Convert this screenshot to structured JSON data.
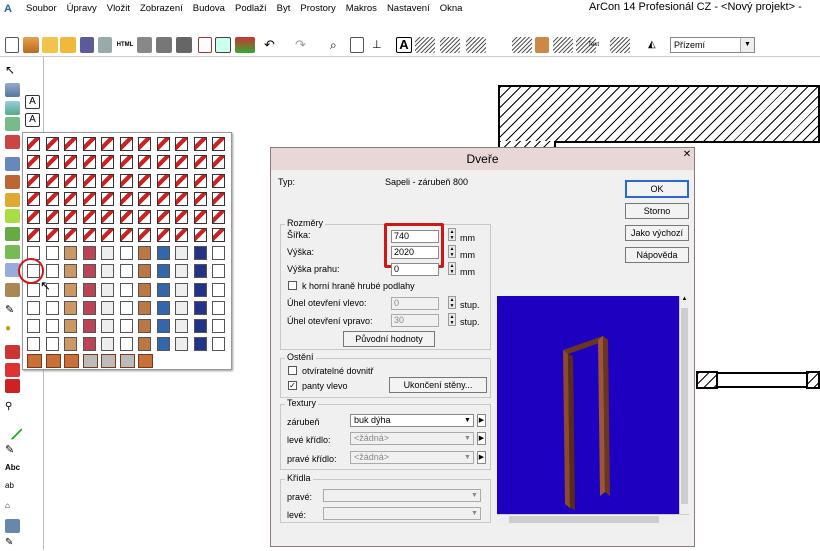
{
  "app": {
    "title": "ArCon 14 Profesionál CZ - <Nový projekt> -",
    "menu": [
      "Soubor",
      "Úpravy",
      "Vložit",
      "Zobrazení",
      "Budova",
      "Podlaží",
      "Byt",
      "Prostory",
      "Makros",
      "Nastavení",
      "Okna"
    ]
  },
  "toolbar": {
    "floor_value": "Přízemí",
    "labels": {
      "html": "HTML",
      "text": "Text"
    }
  },
  "left_toolbar": {
    "text_tool": "Abc"
  },
  "dialog": {
    "title": "Dveře",
    "type_label": "Typ:",
    "type_value": "Sapeli - zárubeň 800",
    "buttons": {
      "ok": "OK",
      "cancel": "Storno",
      "default": "Jako výchozí",
      "help": "Nápověda"
    },
    "rozmery": {
      "label": "Rozměry",
      "sirka_label": "Šířka:",
      "sirka_value": "740",
      "vyska_label": "Výška:",
      "vyska_value": "2020",
      "prah_label": "Výška prahu:",
      "prah_value": "0",
      "unit": "mm",
      "checkbox_label": "k horní hraně hrubé podlahy",
      "uhel_vlevo_label": "Úhel otevření vlevo:",
      "uhel_vlevo_value": "0",
      "uhel_vpravo_label": "Úhel otevření vpravo:",
      "uhel_vpravo_value": "30",
      "angle_unit": "stup.",
      "reset_button": "Původní hodnoty"
    },
    "osteni": {
      "label": "Ostění",
      "cb1_label": "otvíratelné dovnitř",
      "cb1_checked": false,
      "cb2_label": "panty vlevo",
      "cb2_checked": true,
      "walls_button": "Ukončení stěny..."
    },
    "textury": {
      "label": "Textury",
      "zarubne_label": "zárubeň",
      "zarubne_value": "buk dýha",
      "leve_label": "levé křídlo:",
      "leve_value": "<žádná>",
      "prave_label": "pravé křídlo:",
      "prave_value": "<žádná>"
    },
    "kridla": {
      "label": "Křídla",
      "prave_label": "pravé:",
      "leve_label": "levé:"
    }
  },
  "colors": {
    "accent_red": "#cc1818",
    "preview_bg": "#1e00c0",
    "door_frame": "#8b4a2e"
  }
}
